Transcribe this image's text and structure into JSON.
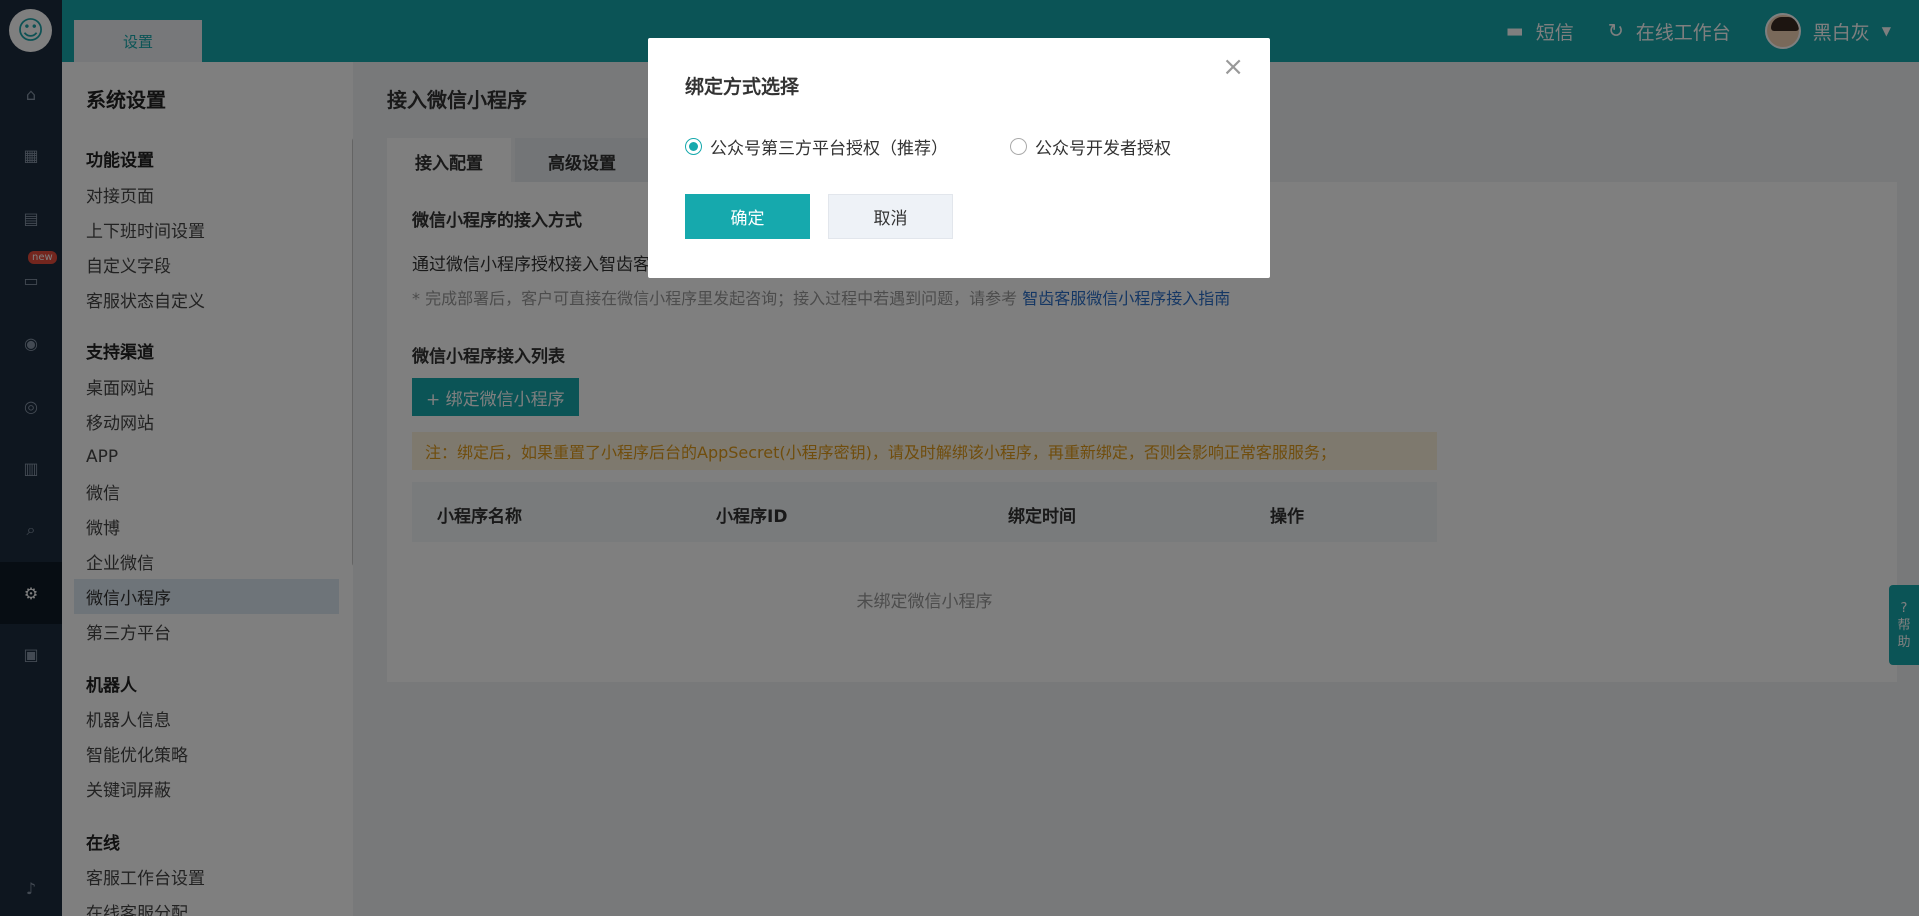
{
  "topbar": {
    "tab": "设置",
    "sms": "短信",
    "workbench": "在线工作台",
    "user": "黑白灰"
  },
  "rail": {
    "badge": "new"
  },
  "sidebar": {
    "title": "系统设置",
    "groups": [
      {
        "label": "功能设置",
        "items": [
          "对接页面",
          "上下班时间设置",
          "自定义字段",
          "客服状态自定义"
        ]
      },
      {
        "label": "支持渠道",
        "items": [
          "桌面网站",
          "移动网站",
          "APP",
          "微信",
          "微博",
          "企业微信",
          "微信小程序",
          "第三方平台"
        ]
      },
      {
        "label": "机器人",
        "items": [
          "机器人信息",
          "智能优化策略",
          "关键词屏蔽"
        ]
      },
      {
        "label": "在线",
        "items": [
          "客服工作台设置",
          "在线客服分配"
        ]
      }
    ],
    "active": "微信小程序"
  },
  "main": {
    "title": "接入微信小程序",
    "tabs": [
      "接入配置",
      "高级设置"
    ],
    "section1_title": "微信小程序的接入方式",
    "section1_desc": "通过微信小程序授权接入智齿客",
    "note_prefix": "* 完成部署后，客户可直接在微信小程序里发起咨询；接入过程中若遇到问题，请参考",
    "note_link": "智齿客服微信小程序接入指南",
    "section2_title": "微信小程序接入列表",
    "bind_button": "+ 绑定微信小程序",
    "warning": "注：绑定后，如果重置了小程序后台的AppSecret(小程序密钥)，请及时解绑该小程序，再重新绑定，否则会影响正常客服服务；",
    "table_headers": [
      "小程序名称",
      "小程序ID",
      "绑定时间",
      "操作"
    ],
    "empty_text": "未绑定微信小程序"
  },
  "help": [
    "帮",
    "助"
  ],
  "modal": {
    "title": "绑定方式选择",
    "option1": "公众号第三方平台授权（推荐）",
    "option2": "公众号开发者授权",
    "selected": 1,
    "ok": "确定",
    "cancel": "取消",
    "close": "×"
  }
}
